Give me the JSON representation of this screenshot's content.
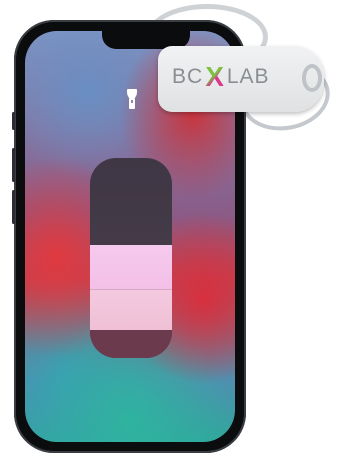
{
  "brand": {
    "logo_left": "BC",
    "logo_x": "X",
    "logo_right": "LAB"
  },
  "control_center": {
    "flashlight_icon": "flashlight-icon",
    "brightness_level": 0.55
  },
  "colors": {
    "logo_text": "#8a8e93",
    "logo_x_green": "#7cc141",
    "logo_x_pink": "#d83a8b",
    "slider_top": "#3f3745",
    "slider_light": "#f6c9ee"
  }
}
